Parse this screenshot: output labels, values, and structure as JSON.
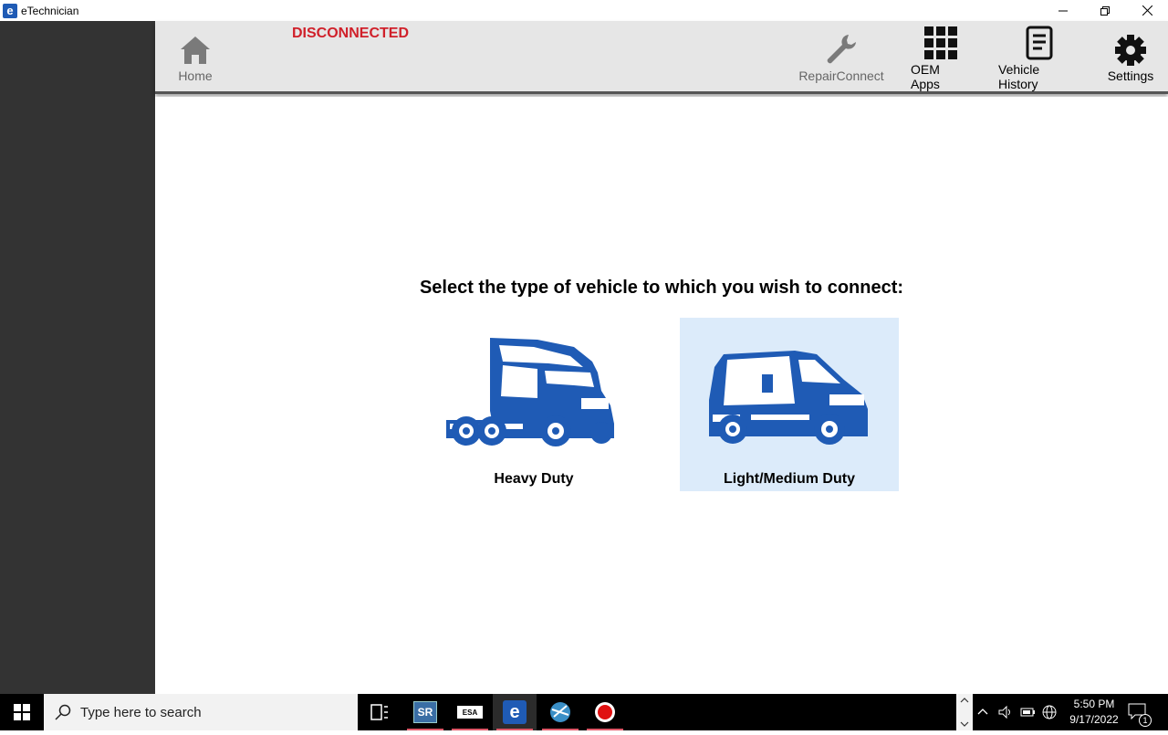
{
  "window": {
    "title": "eTechnician",
    "app_icon_letter": "e"
  },
  "toolbar": {
    "home_label": "Home",
    "status": "DISCONNECTED",
    "repair_label": "RepairConnect",
    "oem_label": "OEM Apps",
    "history_label": "Vehicle History",
    "settings_label": "Settings"
  },
  "main": {
    "prompt": "Select the type of vehicle to which you wish to connect:",
    "options": [
      {
        "label": "Heavy Duty",
        "selected": false
      },
      {
        "label": "Light/Medium Duty",
        "selected": true
      }
    ]
  },
  "taskbar": {
    "search_placeholder": "Type here to search",
    "apps": [
      "SR",
      "ESA",
      "e",
      "globe-app",
      "record"
    ],
    "time": "5:50 PM",
    "date": "9/17/2022",
    "notifications": "1"
  },
  "colors": {
    "accent": "#1f5bb5",
    "status_red": "#d0202a",
    "selected_bg": "#dcebfa",
    "rail": "#333333"
  }
}
